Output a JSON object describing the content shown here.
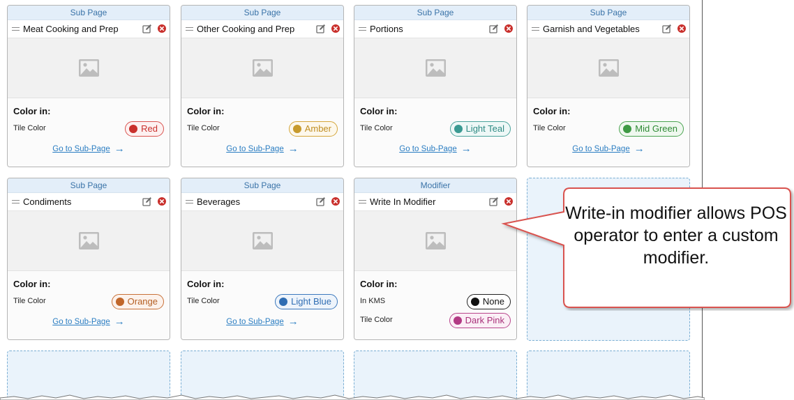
{
  "tiles": [
    {
      "type": "Sub Page",
      "name": "Meat Cooking and Prep",
      "color_heading": "Color in:",
      "props": [
        {
          "label": "Tile Color",
          "value": "Red",
          "dot": "#c9302c",
          "border": "#d9534f",
          "text": "#c9302c",
          "bg": "#fdf1f1"
        }
      ],
      "link": "Go to Sub-Page"
    },
    {
      "type": "Sub Page",
      "name": "Other Cooking and Prep",
      "color_heading": "Color in:",
      "props": [
        {
          "label": "Tile Color",
          "value": "Amber",
          "dot": "#c79a2c",
          "border": "#d4a63a",
          "text": "#c08e22",
          "bg": "#fdf8ec"
        }
      ],
      "link": "Go to Sub-Page"
    },
    {
      "type": "Sub Page",
      "name": "Portions",
      "color_heading": "Color in:",
      "props": [
        {
          "label": "Tile Color",
          "value": "Light Teal",
          "dot": "#3a9a92",
          "border": "#4aa39b",
          "text": "#2e8a83",
          "bg": "#eef8f7"
        }
      ],
      "link": "Go to Sub-Page"
    },
    {
      "type": "Sub Page",
      "name": "Garnish and Vegetables",
      "color_heading": "Color in:",
      "props": [
        {
          "label": "Tile Color",
          "value": "Mid Green",
          "dot": "#3e9a44",
          "border": "#4aa350",
          "text": "#2e8a34",
          "bg": "#eff8ef"
        }
      ],
      "link": "Go to Sub-Page"
    },
    {
      "type": "Sub Page",
      "name": "Condiments",
      "color_heading": "Color in:",
      "props": [
        {
          "label": "Tile Color",
          "value": "Orange",
          "dot": "#c0662a",
          "border": "#c87038",
          "text": "#b45e22",
          "bg": "#fcf2ec"
        }
      ],
      "link": "Go to Sub-Page"
    },
    {
      "type": "Sub Page",
      "name": "Beverages",
      "color_heading": "Color in:",
      "props": [
        {
          "label": "Tile Color",
          "value": "Light Blue",
          "dot": "#2f6db3",
          "border": "#3b78bd",
          "text": "#2f6db3",
          "bg": "#eef4fb"
        }
      ],
      "link": "Go to Sub-Page"
    },
    {
      "type": "Modifier",
      "name": "Write In Modifier",
      "color_heading": "Color in:",
      "props": [
        {
          "label": "In KMS",
          "value": "None",
          "dot": "#111111",
          "border": "#222222",
          "text": "#111111",
          "bg": "#ffffff"
        },
        {
          "label": "Tile Color",
          "value": "Dark Pink",
          "dot": "#b23a84",
          "border": "#b8468c",
          "text": "#a8327a",
          "bg": "#fbeff6"
        }
      ],
      "link": ""
    }
  ],
  "callout": {
    "text": "Write-in modifier allows POS operator to enter a custom modifier."
  },
  "colors": {
    "accent_link": "#2a7dc2",
    "header_band": "#e3eef9",
    "callout_border": "#d9534f"
  },
  "icons": {
    "drag": "drag-handle-icon",
    "edit": "edit-icon",
    "delete": "delete-icon",
    "image": "image-placeholder-icon",
    "arrow": "arrow-right-icon"
  }
}
